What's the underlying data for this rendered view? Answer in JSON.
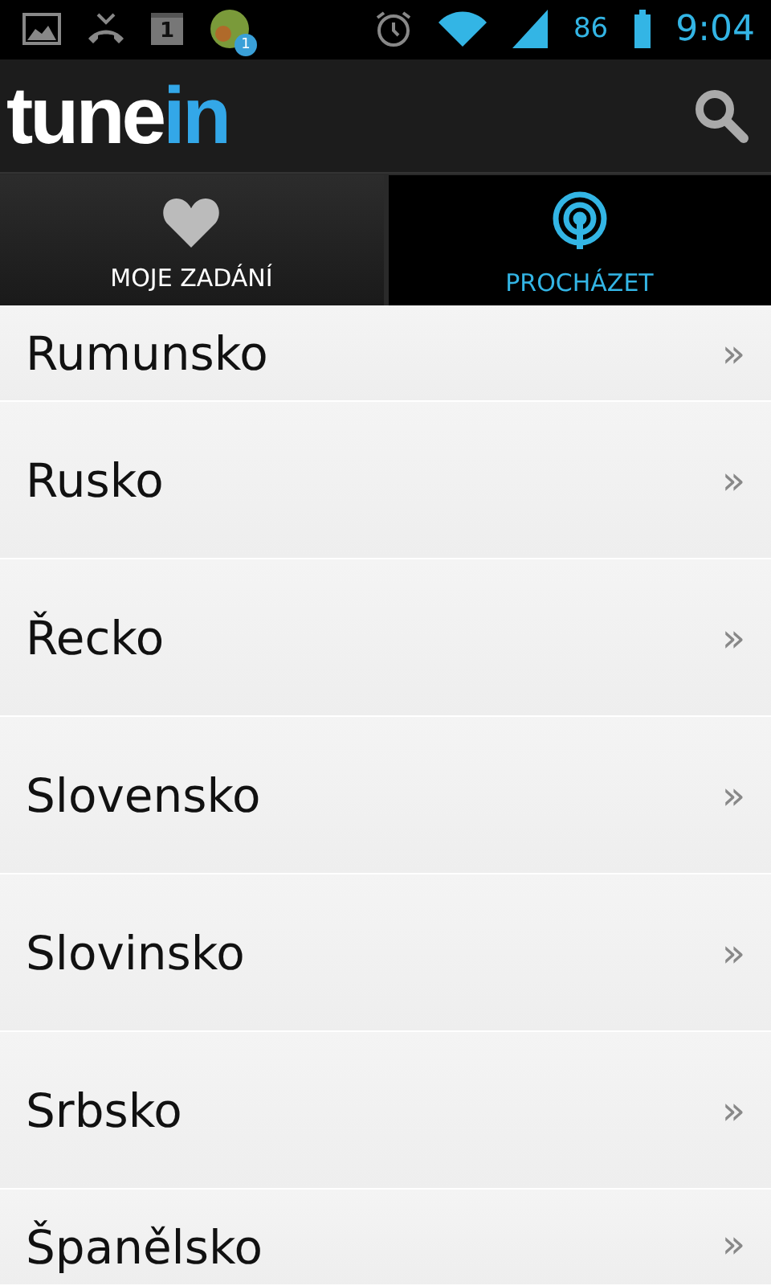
{
  "status_bar": {
    "calendar_day": "1",
    "notification_badge": "1",
    "battery": "86",
    "time": "9:04"
  },
  "app_bar": {
    "logo": {
      "main": "tune",
      "accent": "in"
    }
  },
  "tabs": [
    {
      "label": "MOJE ZADÁNÍ",
      "kind": "heart",
      "selected": false
    },
    {
      "label": "PROCHÁZET",
      "kind": "broadcast",
      "selected": true
    }
  ],
  "list": [
    {
      "label": "Rumunsko",
      "chevron": "»"
    },
    {
      "label": "Rusko",
      "chevron": "»"
    },
    {
      "label": "Řecko",
      "chevron": "»"
    },
    {
      "label": "Slovensko",
      "chevron": "»"
    },
    {
      "label": "Slovinsko",
      "chevron": "»"
    },
    {
      "label": "Srbsko",
      "chevron": "»"
    },
    {
      "label": "Španělsko",
      "chevron": "»"
    }
  ]
}
